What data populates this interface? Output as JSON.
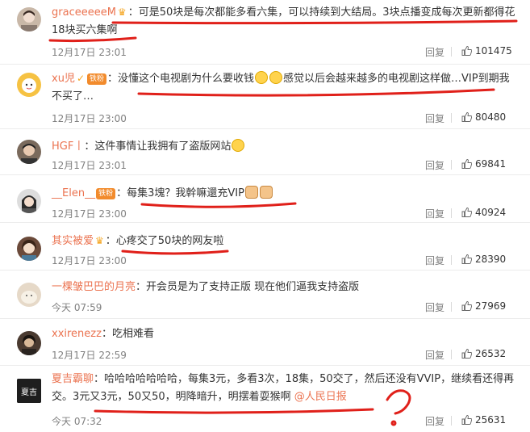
{
  "comments": [
    {
      "user": "graceeeeeM",
      "text": "：可是50块是每次都能多看六集，可以持续到大结局。3块点播变成每次更新都得花18块买六集啊",
      "time": "12月17日 23:01",
      "reply": "回复",
      "likes": "101475",
      "avatar_color": "#c9b8a8"
    },
    {
      "user": "xu児",
      "badge": "铁粉",
      "text_a": "：没懂这个电视剧为什么要收钱",
      "text_b": "感觉以后会越来越多的电视剧这样做…VIP到期我不买了…",
      "time": "12月17日 23:00",
      "reply": "回复",
      "likes": "80480",
      "avatar_color": "#f6c243"
    },
    {
      "user": "HGF丨",
      "text": "：这件事情让我拥有了盗版网站",
      "time": "12月17日 23:01",
      "reply": "回复",
      "likes": "69841",
      "avatar_color": "#7a6a5c"
    },
    {
      "user": "__Elen__",
      "badge": "铁粉",
      "text": "：每集3塊？我幹嘛還充VIP",
      "time": "12月17日 23:00",
      "reply": "回复",
      "likes": "40924",
      "avatar_color": "#3a3a3a"
    },
    {
      "user": "其实被爱",
      "text": "：心疼交了50块的网友啦",
      "time": "12月17日 23:00",
      "reply": "回复",
      "likes": "28390",
      "avatar_color": "#6b4a3a"
    },
    {
      "user": "一棵皱巴巴的月亮",
      "text": "：开会员是为了支持正版  现在他们逼我支持盗版",
      "time": "今天 07:59",
      "reply": "回复",
      "likes": "27969",
      "avatar_color": "#e6d9c8"
    },
    {
      "user": "xxirenezz",
      "text": "：吃相难看",
      "time": "12月17日 22:59",
      "reply": "回复",
      "likes": "26532",
      "avatar_color": "#4a3a30"
    },
    {
      "user": "夏吉霸聊",
      "text": "：哈哈哈哈哈哈哈，每集3元，多看3次，18集，50交了，然后还没有VVIP，继续看还得再交。3元又3元，50又50，明降暗升，明摆着耍猴啊 ",
      "mention": "@人民日报",
      "time": "今天 07:32",
      "reply": "回复",
      "likes": "25631",
      "avatar_color": "#1e1e1e",
      "avatar_text": "夏吉"
    }
  ],
  "colors": {
    "username": "#eb7350",
    "annotation": "#e0201a",
    "meta": "#808080"
  },
  "icons": {
    "like": "thumbs-up-icon",
    "vip": "vip-crown-icon"
  }
}
